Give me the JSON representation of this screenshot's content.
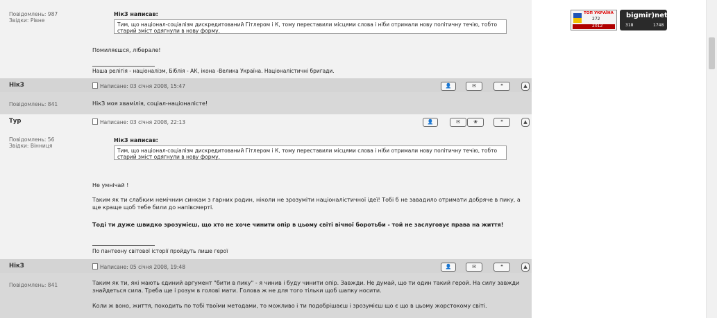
{
  "posts": [
    {
      "meta_count": "Повідомлень: 987",
      "meta_from": "Звідки: Рівне",
      "quote_title": "НікЗ написав:",
      "quote_text": "Тим, що націонал-соціалізм дискредитований Гітлером і К, тому переставили місцями слова і ніби отримали нову політичну течію, тобто старий зміст одягнули в нову форму.",
      "paragraphs": [
        "Помиляєшся, ліберале!"
      ],
      "signature": "Наша релігія - націоналізм, Біблія - АК, ікона -Велика Україна. Націоналістичні бригади."
    },
    {
      "author": "НікЗ",
      "posted": "Написане: 03 січня 2008, 15:47",
      "meta_count": "Повідомлень: 841",
      "paragraphs": [
        "НікЗ моя хвамілія, соціал-націоналісте!"
      ]
    },
    {
      "author": "Тур",
      "posted": "Написане: 03 січня 2008, 22:13",
      "meta_count": "Повідомлень: 56",
      "meta_from": "Звідки: Вінниця",
      "quote_title": "НікЗ написав:",
      "quote_text": "Тим, що націонал-соціалізм дискредитований Гітлером і К, тому переставили місцями слова і ніби отримали нову політичну течію, тобто старий зміст одягнули в нову форму.",
      "paragraphs": [
        "Не умнічай !",
        "Таким як ти слабким немічним синкам з гарних родин, ніколи не зрозуміти націоналістичної ідеї! Тобі б не завадило отримати добряче в пику, а ще краще щоб тебе били до напівсмерті.",
        "Тоді ти дуже швидко зрозумієш, що хто не хоче чинити опір в цьому світі вічної боротьби - той не заслуговує права на життя!"
      ],
      "signature": "По пантеону світової історії пройдуть лише герої"
    },
    {
      "author": "НікЗ",
      "posted": "Написане: 05 січня 2008, 19:48",
      "meta_count": "Повідомлень: 841",
      "paragraphs": [
        "Таким як ти, які мають єдиний аргумент \"бити в пику\" - я чинив і буду чинити опір. Завжди. Не думай, що ти один такий герой. На силу завжди знайдеться сила. Треба ще і розум в голові мати. Голова ж не для того тільки щоб шапку носити.",
        "Коли ж воно, життя, походить по тобі твоїми методами, то можливо і ти подобрішаєш і зрозумієш що є що в цьому жорстокому світі."
      ]
    }
  ],
  "buttons": {
    "profile": "👤",
    "pm": "✉",
    "www": "❀",
    "quote": "❝",
    "top": "▲"
  },
  "counters": {
    "top_ukraine_title": "ТОП УКРАЇНА",
    "top_ukraine_today": "272",
    "top_ukraine_total": "2012",
    "bigmir_title": "bigmir)net",
    "bigmir_visits": "318",
    "bigmir_hits": "1748"
  },
  "colors": {
    "post_bg": "#f2f2f2",
    "header_bg": "#d4d4d4"
  }
}
